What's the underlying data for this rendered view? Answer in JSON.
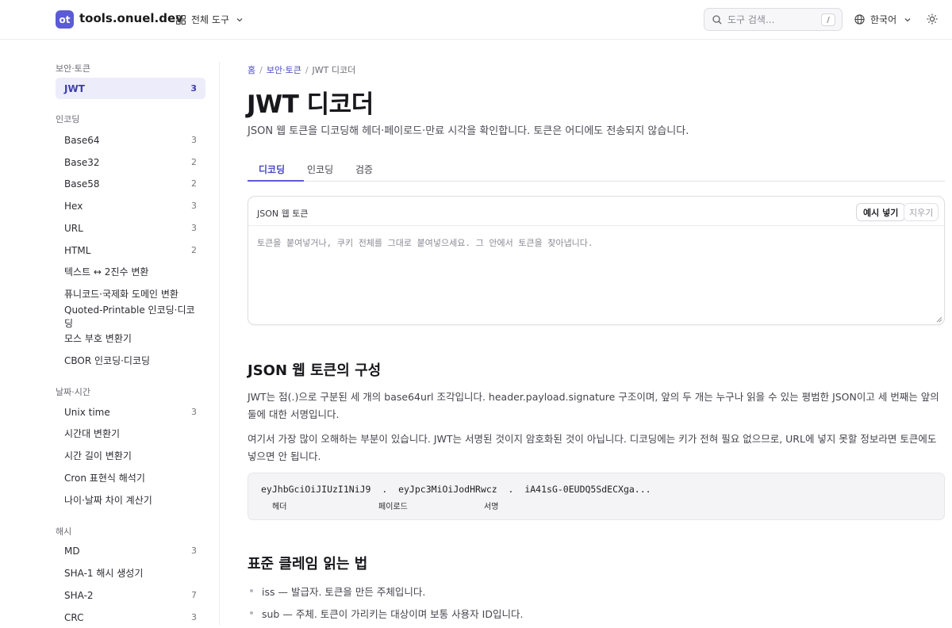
{
  "header": {
    "logo_badge": "ot",
    "site_name": "tools.onuel.dev",
    "all_tools_label": "전체 도구",
    "search_placeholder": "도구 검색...",
    "search_shortcut": "/",
    "language_label": "한국어"
  },
  "sidebar": {
    "categories": [
      {
        "name": "보안·토큰",
        "items": [
          {
            "label": "JWT",
            "count": "3",
            "active": true
          }
        ]
      },
      {
        "name": "인코딩",
        "items": [
          {
            "label": "Base64",
            "count": "3"
          },
          {
            "label": "Base32",
            "count": "2"
          },
          {
            "label": "Base58",
            "count": "2"
          },
          {
            "label": "Hex",
            "count": "3"
          },
          {
            "label": "URL",
            "count": "3"
          },
          {
            "label": "HTML",
            "count": "2"
          },
          {
            "label": "텍스트 ↔ 2진수 변환",
            "count": ""
          },
          {
            "label": "퓨니코드·국제화 도메인 변환",
            "count": ""
          },
          {
            "label": "Quoted-Printable 인코딩·디코딩",
            "count": ""
          },
          {
            "label": "모스 부호 변환기",
            "count": ""
          },
          {
            "label": "CBOR 인코딩·디코딩",
            "count": ""
          }
        ]
      },
      {
        "name": "날짜·시간",
        "items": [
          {
            "label": "Unix time",
            "count": "3"
          },
          {
            "label": "시간대 변환기",
            "count": ""
          },
          {
            "label": "시간 길이 변환기",
            "count": ""
          },
          {
            "label": "Cron 표현식 해석기",
            "count": ""
          },
          {
            "label": "나이·날짜 차이 계산기",
            "count": ""
          }
        ]
      },
      {
        "name": "해시",
        "items": [
          {
            "label": "MD",
            "count": "3"
          },
          {
            "label": "SHA-1 해시 생성기",
            "count": ""
          },
          {
            "label": "SHA-2",
            "count": "7"
          },
          {
            "label": "CRC",
            "count": "3"
          }
        ]
      }
    ]
  },
  "breadcrumb": {
    "home": "홈",
    "section": "보안·토큰",
    "current": "JWT 디코더"
  },
  "page": {
    "title": "JWT 디코더",
    "subtitle": "JSON 웹 토큰을 디코딩해 헤더·페이로드·만료 시각을 확인합니다. 토큰은 어디에도 전송되지 않습니다."
  },
  "tabs": [
    "디코딩",
    "인코딩",
    "검증"
  ],
  "input_card": {
    "label": "JSON 웹 토큰",
    "example_button": "예시 넣기",
    "clear_button": "지우기",
    "placeholder": "토큰을 붙여넣거나, 쿠키 전체를 그대로 붙여넣으세요. 그 안에서 토큰을 찾아냅니다."
  },
  "section1": {
    "heading": "JSON 웹 토큰의 구성",
    "para1": "JWT는 점(.)으로 구분된 세 개의 base64url 조각입니다. header.payload.signature 구조이며, 앞의 두 개는 누구나 읽을 수 있는 평범한 JSON이고 세 번째는 앞의 둘에 대한 서명입니다.",
    "para2": "여기서 가장 많이 오해하는 부분이 있습니다. JWT는 서명된 것이지 암호화된 것이 아닙니다. 디코딩에는 키가 전혀 필요 없으므로, URL에 넣지 못할 정보라면 토큰에도 넣으면 안 됩니다.",
    "code": "eyJhbGciOiJIUzI1NiJ9  .  eyJpc3MiOiJodHRwcz  .  iA41sG-0EUDQ5SdECXga...",
    "captions": [
      "헤더",
      "페이로드",
      "서명"
    ]
  },
  "section2": {
    "heading": "표준 클레임 읽는 법",
    "bullets": [
      "iss — 발급자. 토큰을 만든 주체입니다.",
      "sub — 주체. 토큰이 가리키는 대상이며 보통 사용자 ID입니다."
    ]
  }
}
